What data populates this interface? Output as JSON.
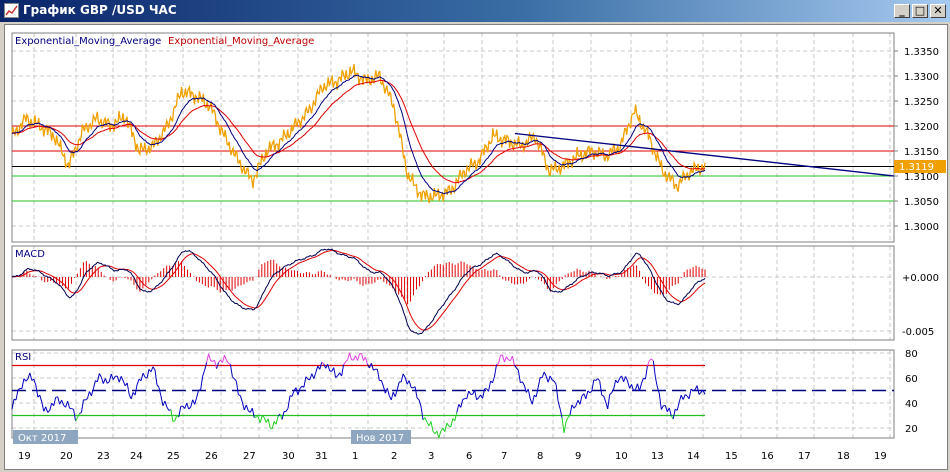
{
  "window": {
    "title": "График GBP /USD  ЧАС",
    "minimize": "_",
    "maximize": "□",
    "close": "✕"
  },
  "legend": {
    "ema_fast": "Exponential_Moving_Average",
    "ema_slow": "Exponential_Moving_Average"
  },
  "panels": {
    "macd_label": "MACD",
    "rsi_label": "RSI"
  },
  "price_axis": [
    "1.3350",
    "1.3300",
    "1.3250",
    "1.3200",
    "1.3150",
    "1.3100",
    "1.3050",
    "1.3000"
  ],
  "current_price": "1.3119",
  "macd_axis": [
    "+0.000",
    "-0.005"
  ],
  "rsi_axis": [
    "80",
    "60",
    "40",
    "20"
  ],
  "month_labels": [
    "Окт 2017",
    "Нов 2017"
  ],
  "date_labels": [
    "19",
    "20",
    "23",
    "24",
    "25",
    "26",
    "27",
    "30",
    "31",
    "1",
    "2",
    "3",
    "6",
    "7",
    "8",
    "9",
    "10",
    "13",
    "14",
    "15",
    "16",
    "17",
    "18",
    "19"
  ],
  "colors": {
    "price": "#f0a000",
    "ema_fast": "#000080",
    "ema_slow": "#e00000",
    "resistance": "#e00000",
    "support": "#20c020",
    "current": "#000000",
    "trend": "#000080",
    "rsi_over": "#e040e0",
    "rsi_under": "#20d020"
  },
  "chart_data": {
    "type": "line",
    "price": [
      1.318,
      1.3215,
      1.32,
      1.318,
      1.312,
      1.319,
      1.3215,
      1.32,
      1.322,
      1.315,
      1.316,
      1.32,
      1.327,
      1.326,
      1.324,
      1.318,
      1.313,
      1.309,
      1.315,
      1.317,
      1.32,
      1.323,
      1.328,
      1.329,
      1.331,
      1.329,
      1.33,
      1.324,
      1.31,
      1.306,
      1.306,
      1.307,
      1.311,
      1.313,
      1.318,
      1.317,
      1.316,
      1.318,
      1.311,
      1.312,
      1.314,
      1.315,
      1.314,
      1.316,
      1.323,
      1.318,
      1.311,
      1.308,
      1.311,
      1.3119
    ],
    "price_range": [
      1.2975,
      1.3375
    ],
    "horizontal_levels": {
      "resistance": [
        1.32,
        1.315
      ],
      "current": 1.3119,
      "support": [
        1.31,
        1.305
      ]
    },
    "trend_line": [
      1.3185,
      1.31
    ],
    "rsi": [
      35,
      58,
      60,
      32,
      42,
      40,
      28,
      45,
      60,
      58,
      62,
      45,
      60,
      68,
      40,
      27,
      38,
      40,
      75,
      72,
      75,
      45,
      32,
      28,
      22,
      30,
      48,
      55,
      65,
      72,
      60,
      75,
      78,
      72,
      60,
      42,
      60,
      55,
      30,
      16,
      18,
      30,
      48,
      45,
      50,
      75,
      77,
      60,
      40,
      62,
      60,
      20,
      40,
      45,
      60,
      38,
      62,
      55,
      50,
      78,
      38,
      30,
      45,
      50,
      50
    ],
    "rsi_levels": [
      70,
      50,
      30
    ],
    "rsi_range": [
      15,
      82
    ],
    "macd_range": [
      -0.0058,
      0.0032
    ]
  }
}
